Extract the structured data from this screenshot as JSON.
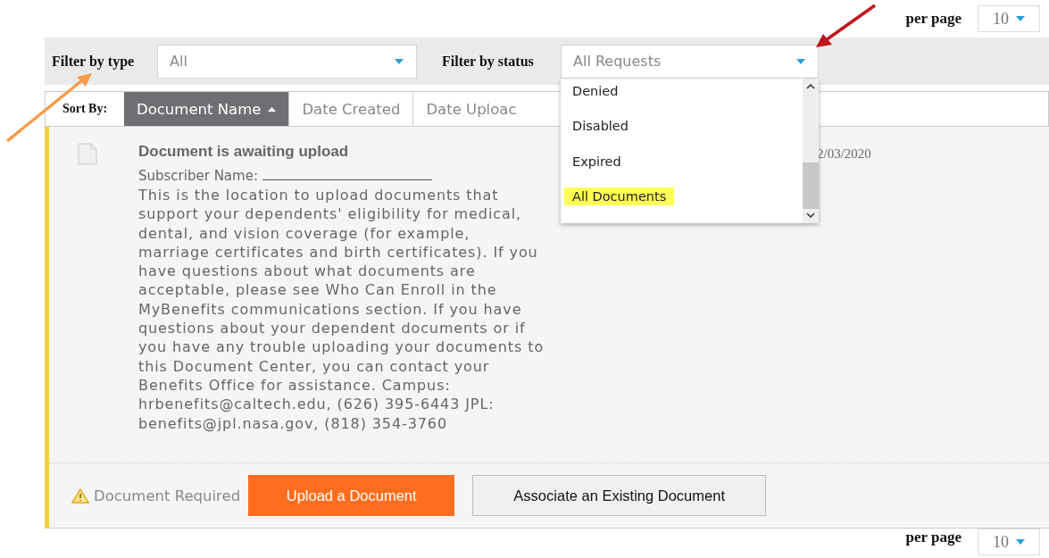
{
  "top_pager": {
    "label": "per page",
    "value": "10"
  },
  "filters": [
    {
      "label": "Filter by type",
      "value": "All"
    },
    {
      "label": "Filter by status",
      "value": "All Requests",
      "options": [
        {
          "label": "Denied",
          "selected": false
        },
        {
          "label": "Disabled",
          "selected": false
        },
        {
          "label": "Expired",
          "selected": false
        },
        {
          "label": "All Documents",
          "selected": true
        }
      ]
    }
  ],
  "sort": {
    "label": "Sort By:",
    "tabs": [
      {
        "label": "Document Name",
        "selected": true
      },
      {
        "label": "Date Created",
        "selected": false
      },
      {
        "label": "Date Uploac",
        "selected": false
      }
    ]
  },
  "document": {
    "title": "Document is awaiting upload",
    "subscriber_label": "Subscriber Name:",
    "description": "This is the location to upload documents that support your dependents' eligibility for medical, dental, and vision coverage (for example, marriage certificates and birth certificates). If you have questions about what documents are acceptable, please see Who Can Enroll in the MyBenefits communications section. If you have questions about your dependent documents or if you have any trouble uploading your documents to this Document Center, you can contact your Benefits Office for assistance. Campus: hrbenefits@caltech.edu, (626) 395-6443 JPL: benefits@jpl.nasa.gov, (818) 354-3760",
    "date": "2/03/2020",
    "status": "Document Required",
    "actions": [
      {
        "label": "Upload a Document",
        "kind": "primary"
      },
      {
        "label": "Associate an Existing Document",
        "kind": "secondary"
      }
    ]
  },
  "bottom_pager": {
    "label": "per page",
    "value": "10"
  }
}
